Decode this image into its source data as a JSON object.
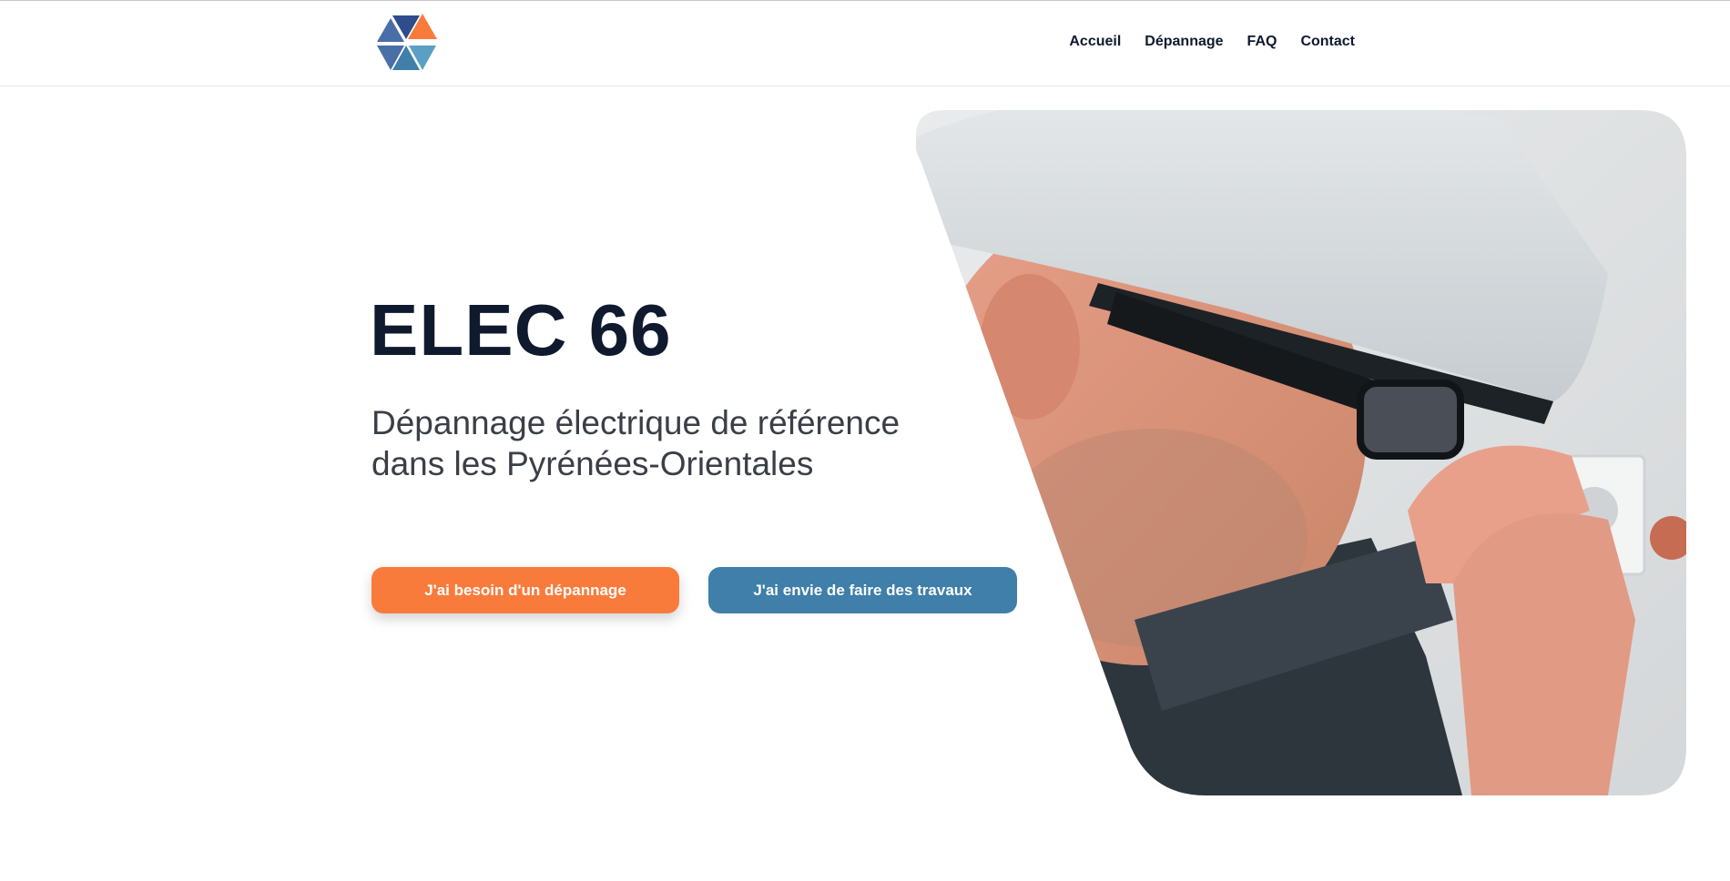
{
  "header": {
    "logo": {
      "icon": "hexagon-triangles-logo",
      "colors": [
        "#2f4d8c",
        "#f97b3c",
        "#4a6ea8",
        "#3f7fa9",
        "#5b9fc4"
      ]
    },
    "nav": [
      {
        "label": "Accueil"
      },
      {
        "label": "Dépannage"
      },
      {
        "label": "FAQ"
      },
      {
        "label": "Contact"
      }
    ]
  },
  "hero": {
    "title": "ELEC 66",
    "subtitle": "Dépannage électrique de référence dans les Pyrénées-Orientales",
    "primary_button": "J'ai besoin d'un dépannage",
    "secondary_button": "J'ai envie de faire des travaux",
    "image": {
      "subject": "electrician-photo"
    }
  },
  "colors": {
    "text_dark": "#0f1a2e",
    "accent_orange": "#f97b3c",
    "accent_blue": "#3f7fa9"
  }
}
